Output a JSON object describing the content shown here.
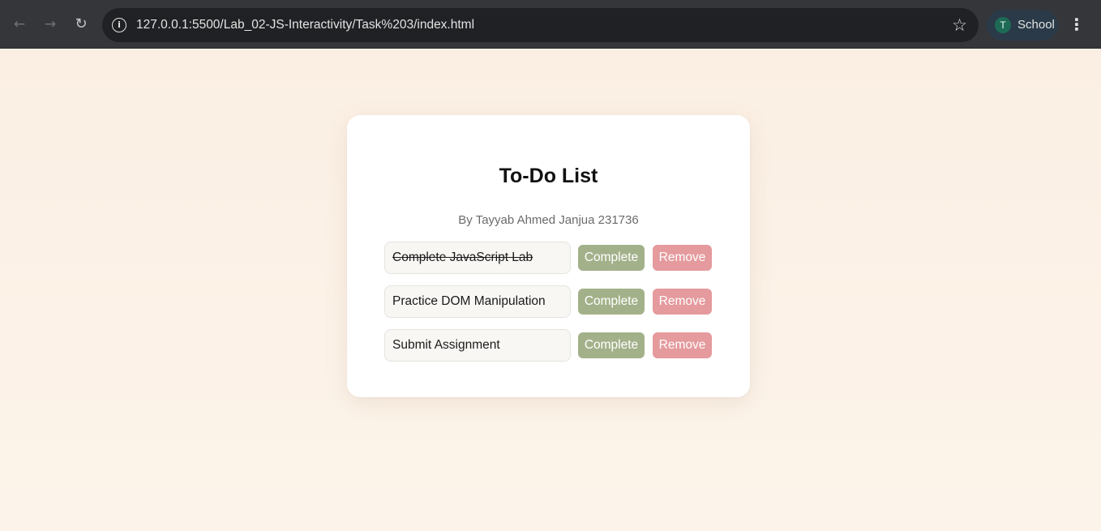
{
  "browser": {
    "url": "127.0.0.1:5500/Lab_02-JS-Interactivity/Task%203/index.html",
    "profile_initial": "T",
    "profile_name": "School",
    "icons": {
      "back": "arrow-left-icon",
      "forward": "arrow-right-icon",
      "reload": "reload-icon",
      "site_info": "info-icon",
      "bookmark": "star-icon",
      "menu": "kebab-menu-icon"
    }
  },
  "page": {
    "title": "To-Do List",
    "subtitle": "By Tayyab Ahmed Janjua 231736",
    "tasks": [
      {
        "text": "Complete JavaScript Lab",
        "completed": true,
        "complete_label": "Complete",
        "remove_label": "Remove"
      },
      {
        "text": "Practice DOM Manipulation",
        "completed": false,
        "complete_label": "Complete",
        "remove_label": "Remove"
      },
      {
        "text": "Submit Assignment",
        "completed": false,
        "complete_label": "Complete",
        "remove_label": "Remove"
      }
    ]
  },
  "colors": {
    "background": "#faf1e6",
    "card": "#ffffff",
    "complete_button": "#a3b18a",
    "remove_button": "#e59a9d",
    "toolbar": "#35363a"
  }
}
